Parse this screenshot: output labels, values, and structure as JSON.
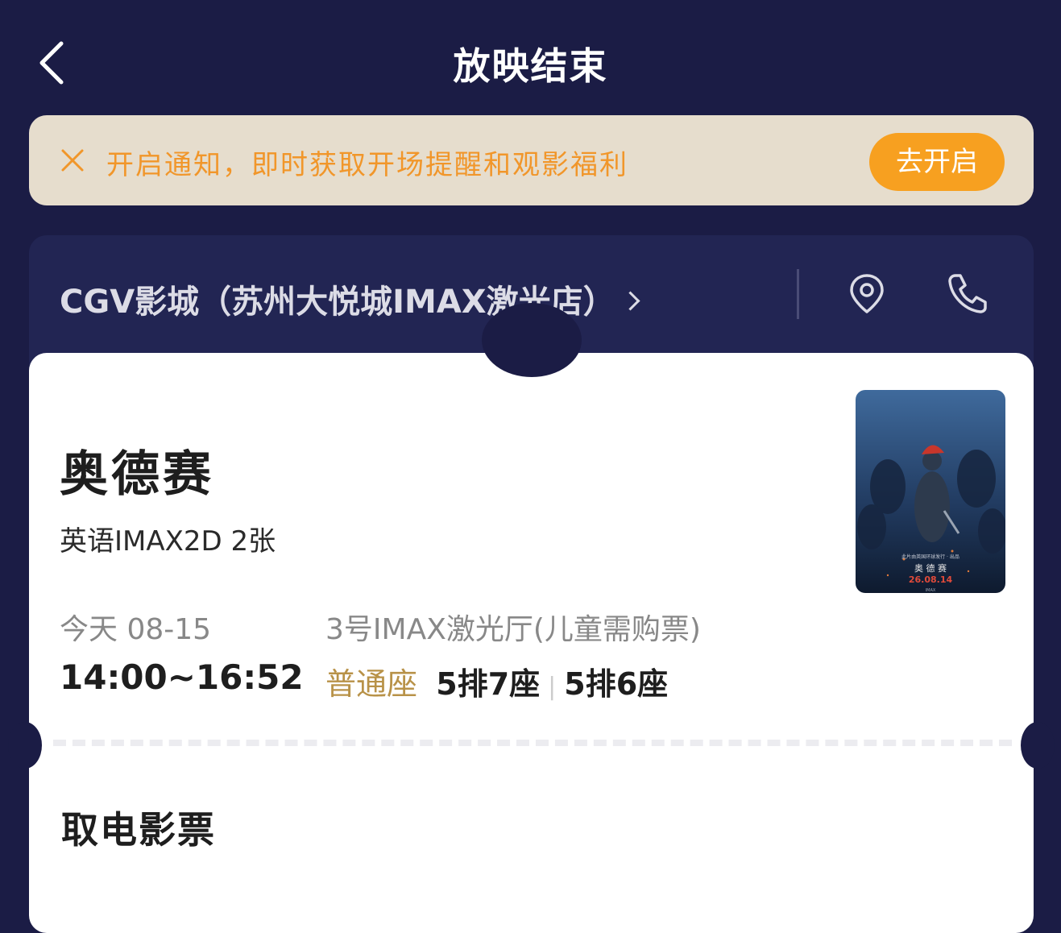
{
  "header": {
    "title": "放映结束",
    "back_icon": "chevron-left-icon"
  },
  "notice": {
    "text": "开启通知，即时获取开场提醒和观影福利",
    "button": "去开启",
    "close_icon": "close-icon",
    "colors": {
      "background": "#e6ddcd",
      "text": "#f1962a",
      "button": "#f7a020"
    }
  },
  "cinema": {
    "name": "CGV影城（苏州大悦城IMAX激光店）",
    "location_icon": "map-pin-icon",
    "phone_icon": "phone-icon"
  },
  "ticket": {
    "movie_title": "奥德赛",
    "meta": "英语IMAX2D 2张",
    "date": "今天 08-15",
    "time": "14:00~16:52",
    "hall": "3号IMAX激光厅(儿童需购票)",
    "seat_type": "普通座",
    "seats": [
      "5排7座",
      "5排6座"
    ],
    "poster": {
      "title": "奥 德 赛",
      "date": "26.08.14",
      "credits": "此片由英国环球发行 · 出品",
      "bottom": "IMAX"
    }
  },
  "pickup": {
    "title": "取电影票"
  },
  "colors": {
    "page_background": "#1b1c45",
    "seat_type": "#b89248"
  }
}
